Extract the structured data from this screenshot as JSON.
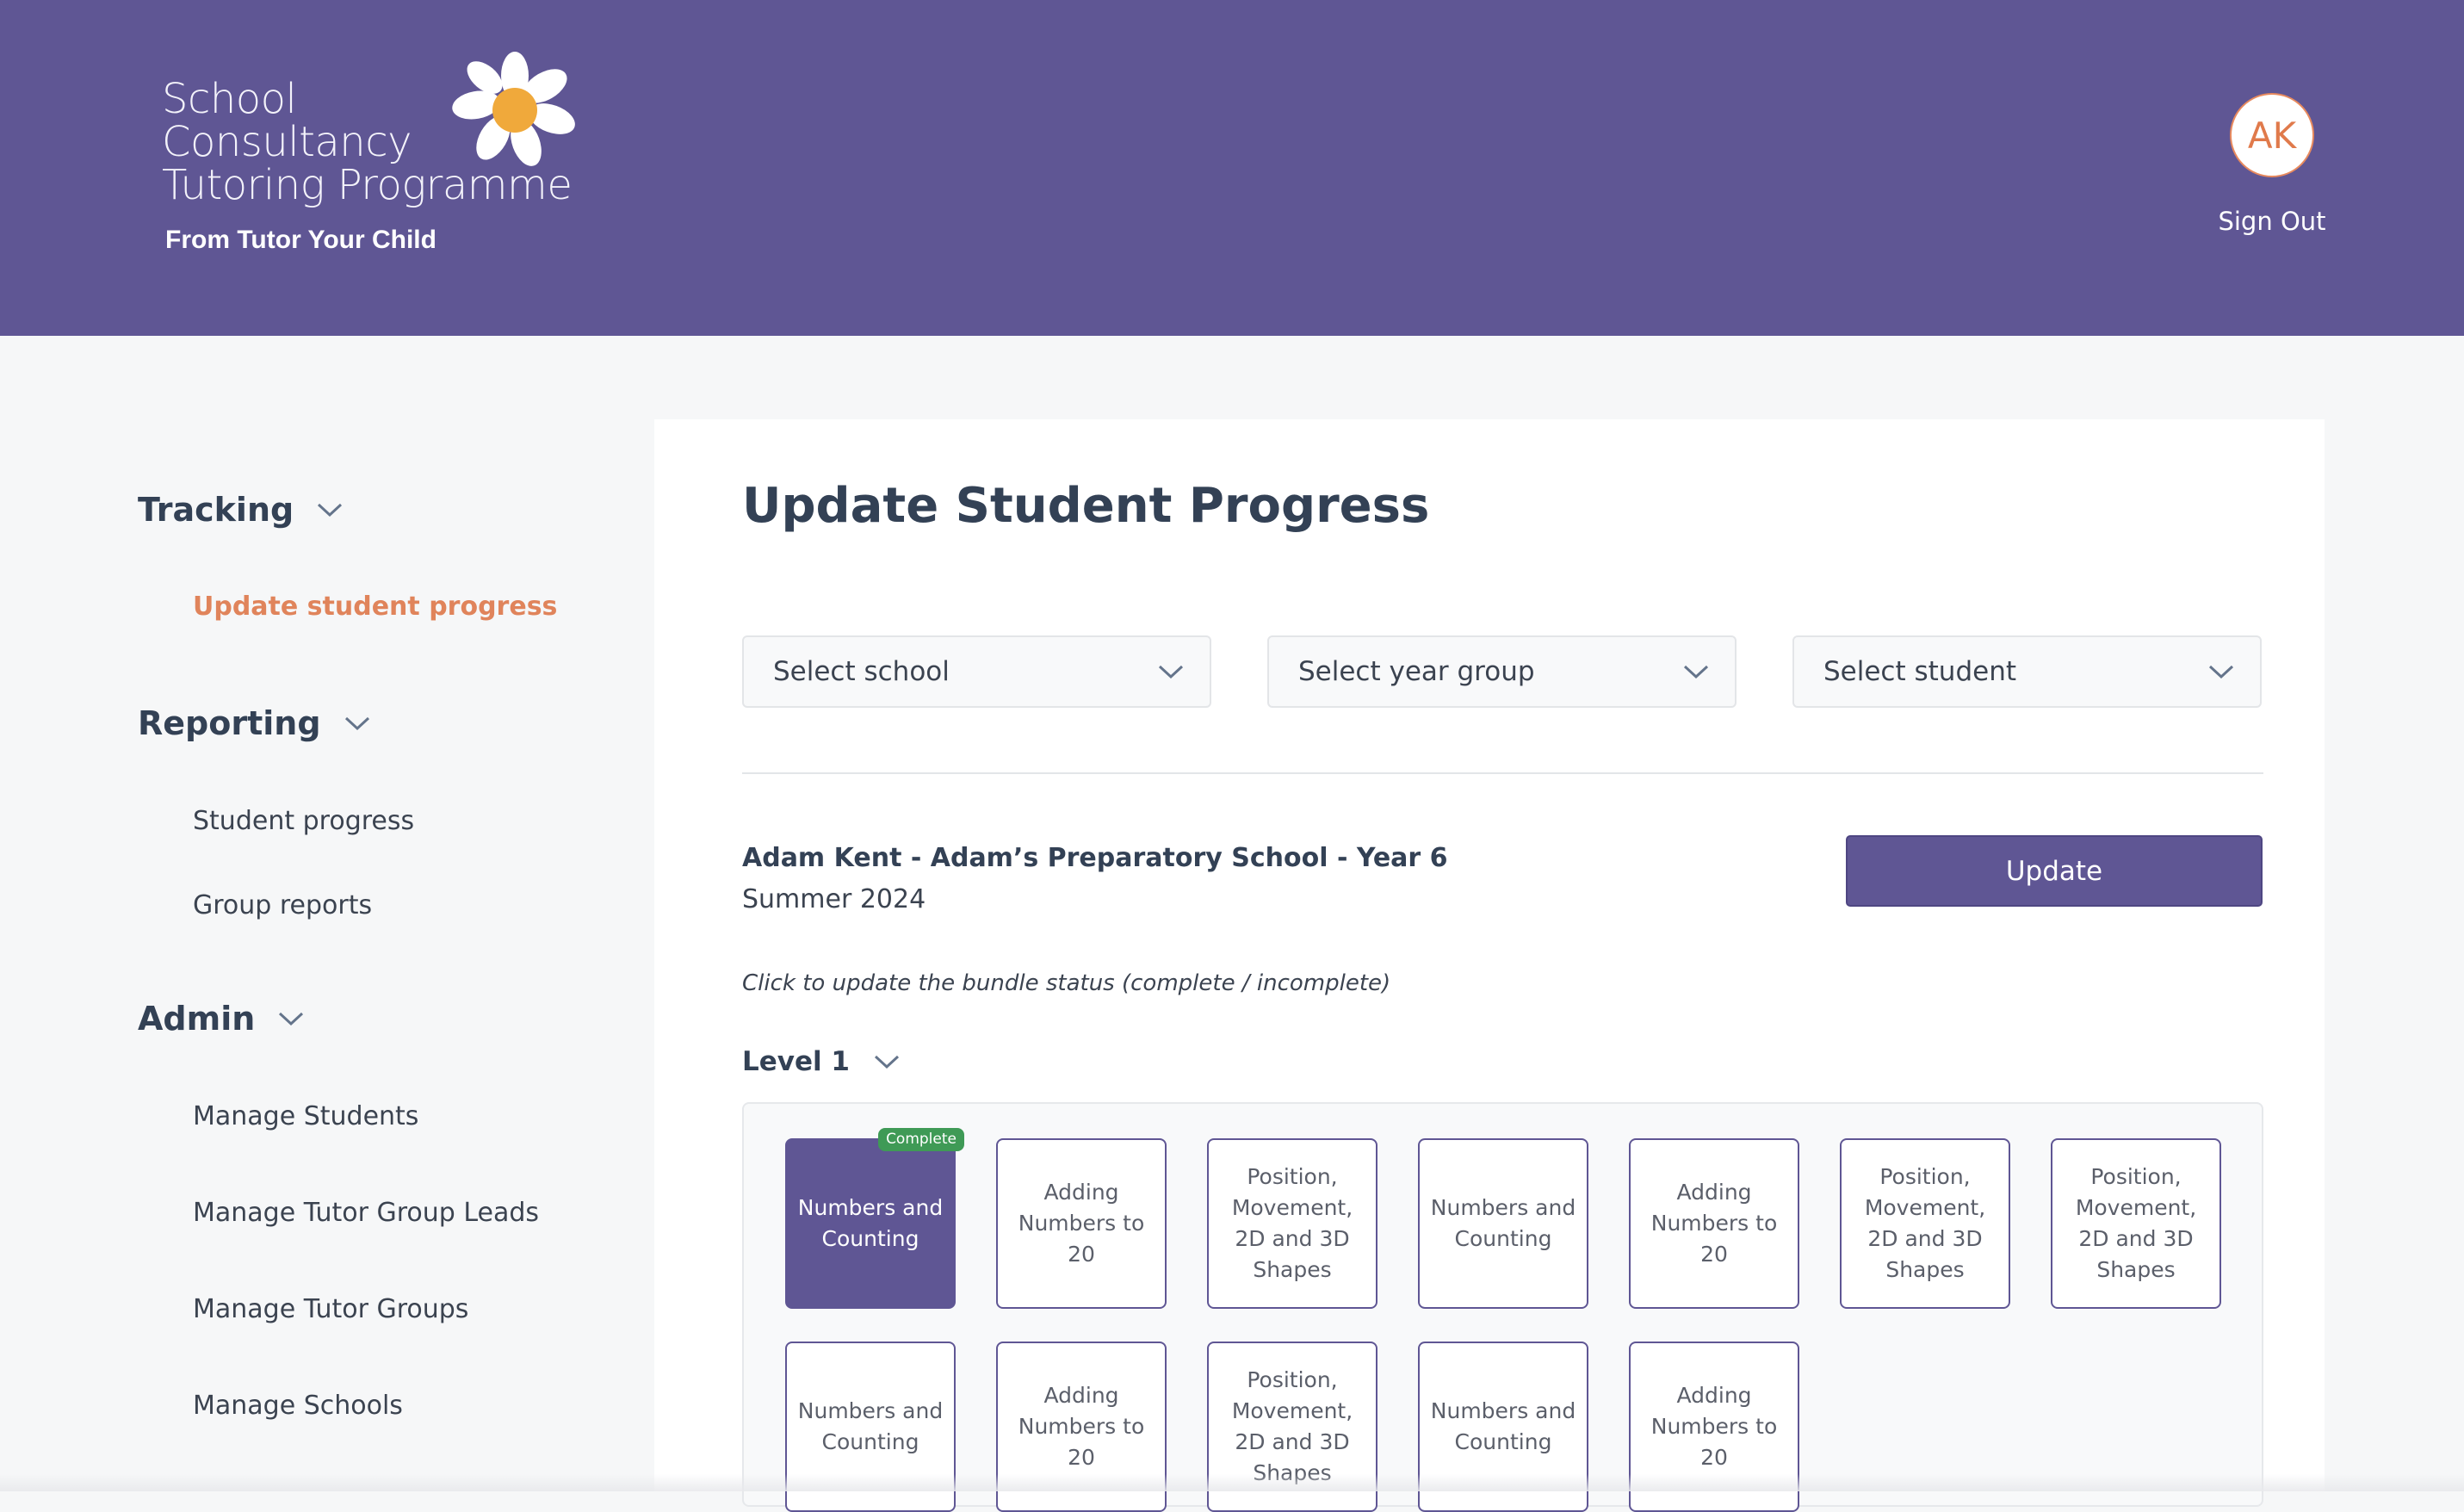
{
  "header": {
    "logo_lines": [
      "School",
      "Consultancy",
      "Tutoring Programme"
    ],
    "logo_tagline": "From Tutor Your Child",
    "avatar_initials": "AK",
    "sign_out_label": "Sign Out"
  },
  "colors": {
    "brand": "#5f5694",
    "accent": "#e0845b",
    "complete_badge": "#3f9a56"
  },
  "sidebar": {
    "sections": [
      {
        "label": "Tracking",
        "items": [
          {
            "label": "Update student progress",
            "active": true
          }
        ]
      },
      {
        "label": "Reporting",
        "items": [
          {
            "label": "Student progress"
          },
          {
            "label": "Group reports"
          }
        ]
      },
      {
        "label": "Admin",
        "items": [
          {
            "label": "Manage Students"
          },
          {
            "label": "Manage Tutor Group Leads"
          },
          {
            "label": "Manage Tutor Groups"
          },
          {
            "label": "Manage Schools"
          }
        ]
      }
    ]
  },
  "main": {
    "title": "Update Student Progress",
    "selects": [
      {
        "label": "Select school"
      },
      {
        "label": "Select year group"
      },
      {
        "label": "Select student"
      }
    ],
    "student_line": "Adam Kent - Adam’s Preparatory School - Year 6",
    "term": "Summer 2024",
    "update_label": "Update",
    "hint": "Click to update the bundle status (complete / incomplete)",
    "level_label": "Level 1",
    "complete_badge": "Complete",
    "bundles": [
      {
        "label": "Numbers and Counting",
        "complete": true
      },
      {
        "label": "Adding Numbers to 20",
        "complete": false
      },
      {
        "label": "Position, Movement, 2D and 3D Shapes",
        "complete": false
      },
      {
        "label": "Numbers and Counting",
        "complete": false
      },
      {
        "label": "Adding Numbers to 20",
        "complete": false
      },
      {
        "label": "Position, Movement, 2D and 3D Shapes",
        "complete": false
      },
      {
        "label": "Position, Movement, 2D and 3D Shapes",
        "complete": false
      },
      {
        "label": "Numbers and Counting",
        "complete": false
      },
      {
        "label": "Adding Numbers to 20",
        "complete": false
      },
      {
        "label": "Position, Movement, 2D and 3D Shapes",
        "complete": false
      },
      {
        "label": "Numbers and Counting",
        "complete": false
      },
      {
        "label": "Adding Numbers to 20",
        "complete": false
      }
    ]
  }
}
